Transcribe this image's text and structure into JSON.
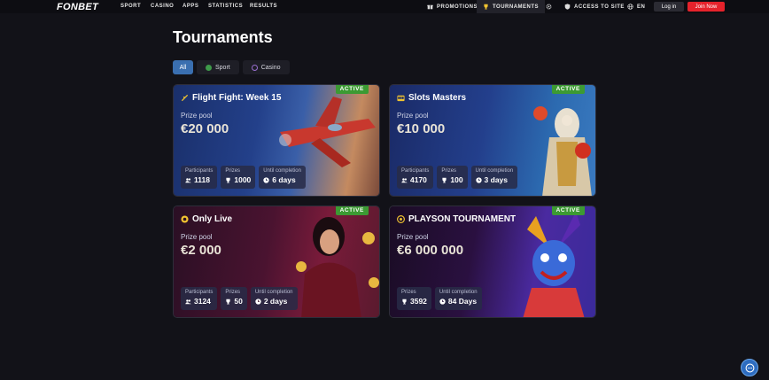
{
  "header": {
    "logo": "FONBET",
    "nav": [
      "SPORT",
      "CASINO",
      "APPS",
      "STATISTICS",
      "RESULTS"
    ],
    "promotions": "PROMOTIONS",
    "tournaments": "TOURNAMENTS",
    "access": "ACCESS TO SITE",
    "language": "EN",
    "login": "Log in",
    "join": "Join Now"
  },
  "page": {
    "title": "Tournaments",
    "filters": [
      "All",
      "Sport",
      "Casino"
    ],
    "active_filter": "All"
  },
  "cards": [
    {
      "title": "Flight Fight: Week 15",
      "status": "ACTIVE",
      "pool_label": "Prize pool",
      "pool": "€20 000",
      "stats": [
        {
          "label": "Participants",
          "value": "1118"
        },
        {
          "label": "Prizes",
          "value": "1000"
        },
        {
          "label": "Until completion",
          "value": "6 days"
        }
      ]
    },
    {
      "title": "Slots Masters",
      "status": "ACTIVE",
      "pool_label": "Prize pool",
      "pool": "€10 000",
      "stats": [
        {
          "label": "Participants",
          "value": "4170"
        },
        {
          "label": "Prizes",
          "value": "100"
        },
        {
          "label": "Until completion",
          "value": "3 days"
        }
      ]
    },
    {
      "title": "Only Live",
      "status": "ACTIVE",
      "pool_label": "Prize pool",
      "pool": "€2 000",
      "stats": [
        {
          "label": "Participants",
          "value": "3124"
        },
        {
          "label": "Prizes",
          "value": "50"
        },
        {
          "label": "Until completion",
          "value": "2 days"
        }
      ]
    },
    {
      "title": "PLAYSON TOURNAMENT",
      "status": "ACTIVE",
      "pool_label": "Prize pool",
      "pool": "€6 000 000",
      "stats": [
        {
          "label": "Prizes",
          "value": "3592"
        },
        {
          "label": "Until completion",
          "value": "84 Days"
        }
      ]
    }
  ],
  "colors": {
    "accent": "#3a6fb0",
    "join": "#e6222b",
    "active_badge": "#3c9a33",
    "background": "#121218"
  }
}
